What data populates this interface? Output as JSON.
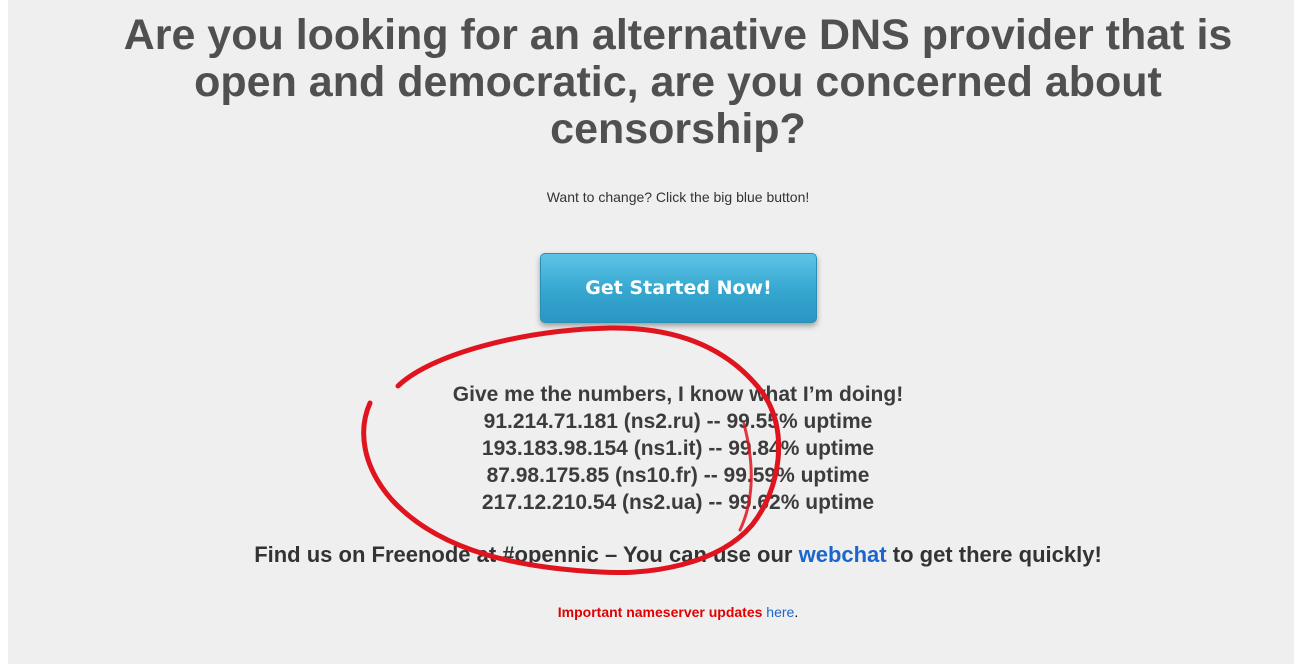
{
  "hero": {
    "headline_line1": "Are you looking for an alternative DNS provider that is",
    "headline_line2": "open and democratic, are you concerned about",
    "headline_line3": "censorship?",
    "tagline": "Want to change? Click the big blue button!",
    "cta_label": "Get Started Now!"
  },
  "numbers": {
    "heading": "Give me the numbers, I know what I’m doing!",
    "servers": [
      "91.214.71.181 (ns2.ru) -- 99.55% uptime",
      "193.183.98.154 (ns1.it) -- 99.84% uptime",
      "87.98.175.85 (ns10.fr) -- 99.59% uptime",
      "217.12.210.54 (ns2.ua) -- 99.62% uptime"
    ]
  },
  "irc": {
    "prefix": "Find us on Freenode at #opennic – You can use our",
    "link": "webchat",
    "suffix": "to get there quickly!"
  },
  "notice": {
    "warning": "Important nameserver updates",
    "link": "here",
    "period": "."
  },
  "colors": {
    "background": "#efefef",
    "headline": "#505050",
    "button": "#34a6cf",
    "link": "#1a66cc",
    "warning": "#e00000",
    "annotation": "#e0141e"
  }
}
